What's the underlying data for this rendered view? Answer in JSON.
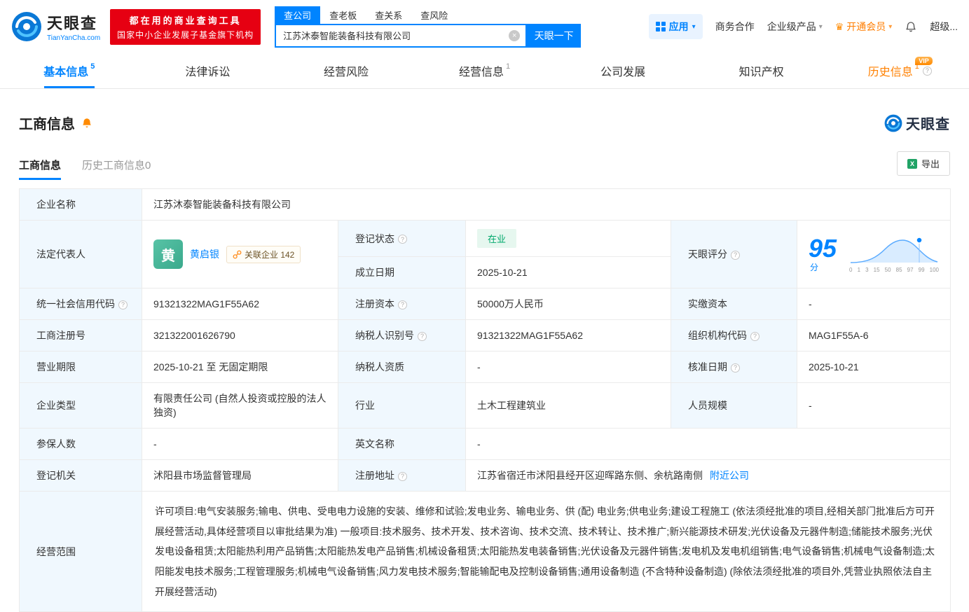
{
  "icons": {
    "clear": "×",
    "caret": "▾",
    "info": "?",
    "excel": "X",
    "crown": "♛"
  },
  "topbar": {
    "logo": {
      "cn": "天眼查",
      "en": "TianYanCha.com"
    },
    "promo": [
      "都在用的商业查询工具",
      "国家中小企业发展子基金旗下机构"
    ],
    "search_tabs": [
      "查公司",
      "查老板",
      "查关系",
      "查风险"
    ],
    "search": {
      "value": "江苏沐泰智能装备科技有限公司",
      "button": "天眼一下"
    },
    "apps_label": "应用",
    "links": [
      "商务合作",
      "企业级产品",
      "开通会员",
      "超级..."
    ]
  },
  "nav_tabs": [
    {
      "label": "基本信息",
      "count": "5"
    },
    {
      "label": "法律诉讼",
      "count": ""
    },
    {
      "label": "经营风险",
      "count": ""
    },
    {
      "label": "经营信息",
      "count": "1"
    },
    {
      "label": "公司发展",
      "count": ""
    },
    {
      "label": "知识产权",
      "count": ""
    },
    {
      "label": "历史信息",
      "count": "1",
      "vip": "VIP"
    }
  ],
  "section": {
    "title": "工商信息",
    "brand": "天眼查",
    "subtabs": [
      "工商信息",
      "历史工商信息0"
    ],
    "export": "导出"
  },
  "info": {
    "company_name": {
      "label": "企业名称",
      "value": "江苏沐泰智能装备科技有限公司"
    },
    "legal_rep": {
      "label": "法定代表人",
      "avatar": "黄",
      "name": "黄启银",
      "related": "关联企业 142"
    },
    "reg_status": {
      "label": "登记状态",
      "value": "在业"
    },
    "establish_date": {
      "label": "成立日期",
      "value": "2025-10-21"
    },
    "score": {
      "label": "天眼评分",
      "value": "95",
      "unit": "分",
      "ticks": [
        "0",
        "1",
        "3",
        "15",
        "50",
        "85",
        "97",
        "99",
        "100"
      ]
    },
    "credit_code": {
      "label": "统一社会信用代码",
      "value": "91321322MAG1F55A62"
    },
    "reg_capital": {
      "label": "注册资本",
      "value": "50000万人民币"
    },
    "paid_capital": {
      "label": "实缴资本",
      "value": "-"
    },
    "reg_number": {
      "label": "工商注册号",
      "value": "321322001626790"
    },
    "taxpayer_id": {
      "label": "纳税人识别号",
      "value": "91321322MAG1F55A62"
    },
    "org_code": {
      "label": "组织机构代码",
      "value": "MAG1F55A-6"
    },
    "business_term": {
      "label": "营业期限",
      "value": "2025-10-21 至 无固定期限"
    },
    "taxpayer_quality": {
      "label": "纳税人资质",
      "value": "-"
    },
    "approved_date": {
      "label": "核准日期",
      "value": "2025-10-21"
    },
    "company_type": {
      "label": "企业类型",
      "value": "有限责任公司 (自然人投资或控股的法人独资)"
    },
    "industry": {
      "label": "行业",
      "value": "土木工程建筑业"
    },
    "staff_size": {
      "label": "人员规模",
      "value": "-"
    },
    "insured": {
      "label": "参保人数",
      "value": "-"
    },
    "english_name": {
      "label": "英文名称",
      "value": "-"
    },
    "registry": {
      "label": "登记机关",
      "value": "沭阳县市场监督管理局"
    },
    "address": {
      "label": "注册地址",
      "value": "江苏省宿迁市沭阳县经开区迎晖路东侧、余杭路南侧",
      "link": "附近公司"
    },
    "scope": {
      "label": "经营范围",
      "value": "许可项目:电气安装服务;输电、供电、受电电力设施的安装、维修和试验;发电业务、输电业务、供 (配) 电业务;供电业务;建设工程施工 (依法须经批准的项目,经相关部门批准后方可开展经营活动,具体经营项目以审批结果为准) 一般项目:技术服务、技术开发、技术咨询、技术交流、技术转让、技术推广;新兴能源技术研发;光伏设备及元器件制造;储能技术服务;光伏发电设备租赁;太阳能热利用产品销售;太阳能热发电产品销售;机械设备租赁;太阳能热发电装备销售;光伏设备及元器件销售;发电机及发电机组销售;电气设备销售;机械电气设备制造;太阳能发电技术服务;工程管理服务;机械电气设备销售;风力发电技术服务;智能输配电及控制设备销售;通用设备制造 (不含特种设备制造) (除依法须经批准的项目外,凭营业执照依法自主开展经营活动)"
    }
  }
}
